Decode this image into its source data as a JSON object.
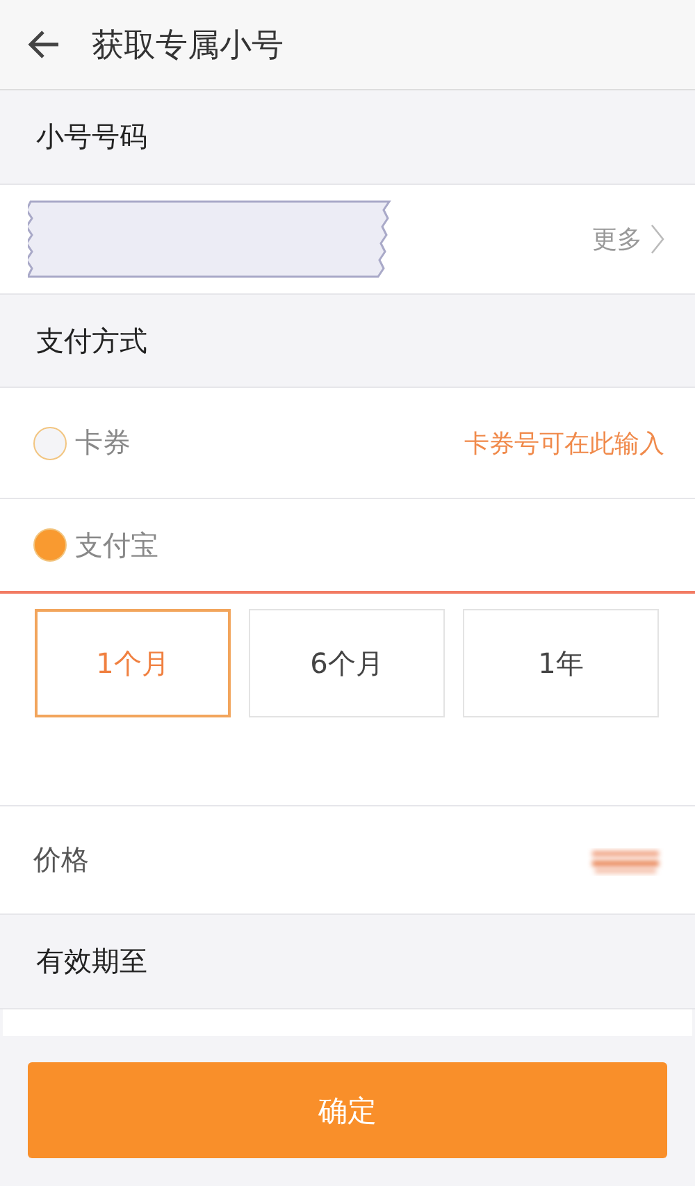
{
  "header": {
    "title": "获取专属小号"
  },
  "number_section": {
    "title": "小号号码",
    "more": "更多"
  },
  "payment_section": {
    "title": "支付方式"
  },
  "payment_methods": [
    {
      "label": "卡券",
      "selected": false,
      "hint": "卡券号可在此输入"
    },
    {
      "label": "支付宝",
      "selected": true
    }
  ],
  "plans": [
    {
      "label": "1个月",
      "selected": true
    },
    {
      "label": "6个月",
      "selected": false
    },
    {
      "label": "1年",
      "selected": false
    }
  ],
  "price": {
    "label": "价格"
  },
  "expiry": {
    "label": "有效期至"
  },
  "confirm_button": "确定"
}
